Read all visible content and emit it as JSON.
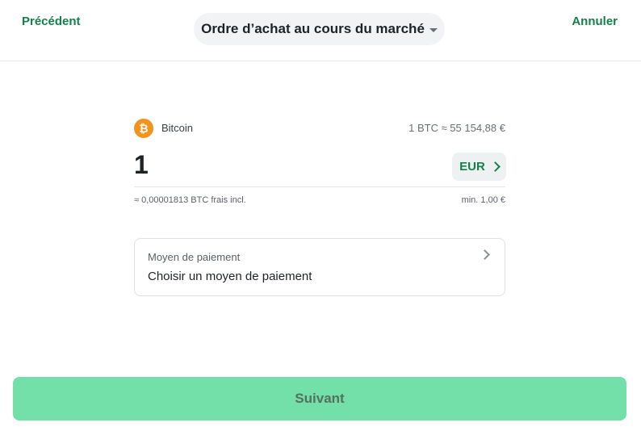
{
  "header": {
    "back_label": "Précédent",
    "title": "Ordre d’achat au cours du marché",
    "cancel_label": "Annuler"
  },
  "asset": {
    "icon": "bitcoin-icon",
    "icon_glyph": "₿",
    "name": "Bitcoin",
    "rate": "1 BTC ≈ 55 154,88 €"
  },
  "amount": {
    "value": "1",
    "currency": "EUR"
  },
  "details": {
    "fee_text": "≈ 0,00001813 BTC frais incl.",
    "min_text": "min. 1,00 €"
  },
  "payment": {
    "label": "Moyen de paiement",
    "value": "Choisir un moyen de paiement"
  },
  "footer": {
    "next_label": "Suivant"
  },
  "colors": {
    "accent": "#14804a",
    "button_bg": "#72e0a8",
    "bitcoin": "#f2931b"
  }
}
